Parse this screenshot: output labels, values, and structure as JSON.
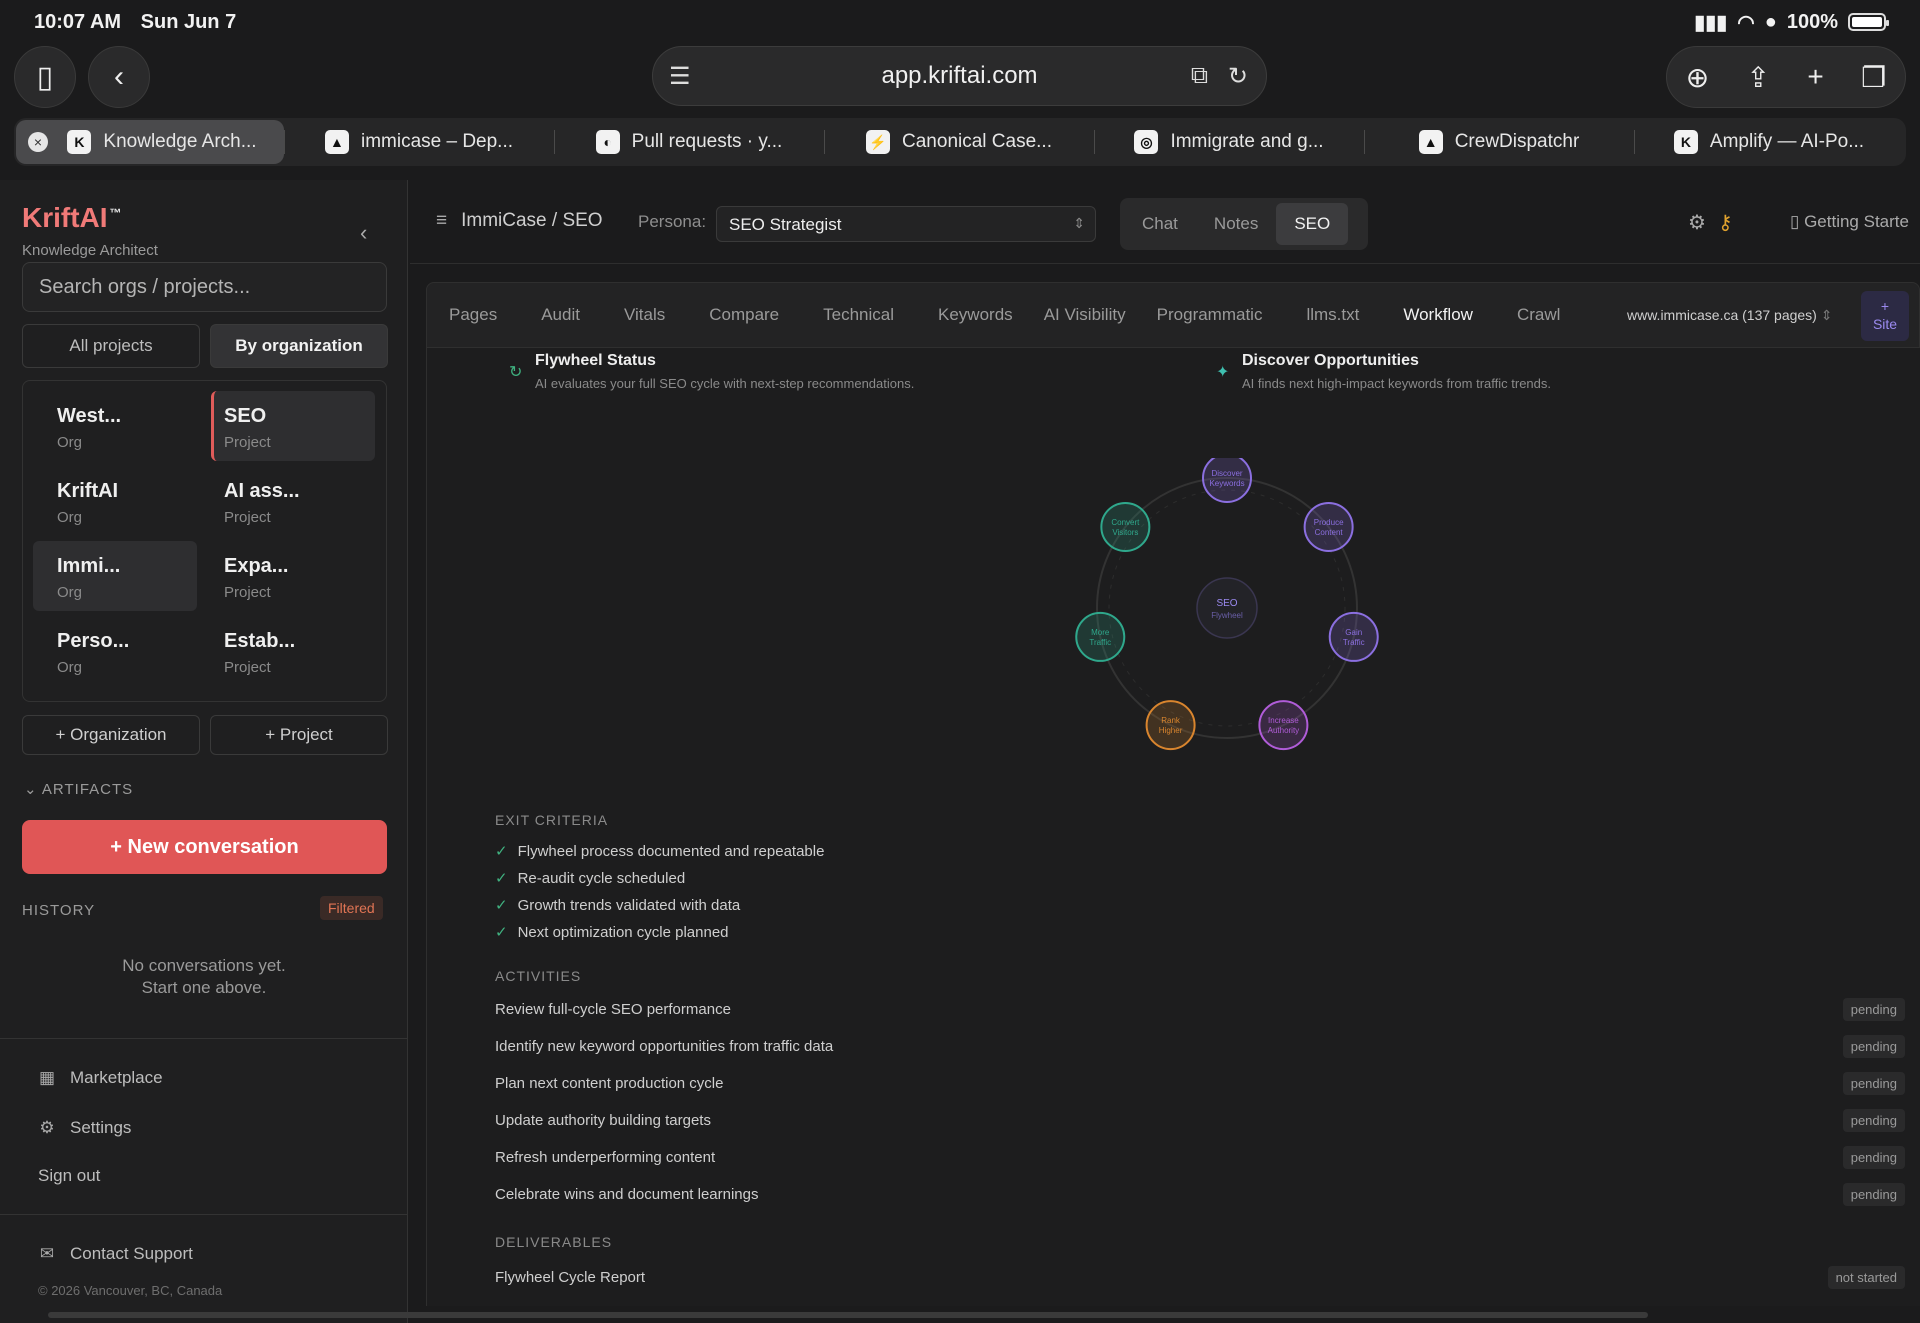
{
  "status": {
    "time": "10:07 AM",
    "date": "Sun Jun 7",
    "battery": "100%",
    "battery_level": 1.0
  },
  "browser": {
    "url": "app.kriftai.com",
    "tabs": [
      {
        "label": "Knowledge Arch...",
        "fav": "K",
        "active": true
      },
      {
        "label": "immicase – Dep...",
        "fav": "▲"
      },
      {
        "label": "Pull requests · y...",
        "fav": "◐"
      },
      {
        "label": "Canonical Case...",
        "fav": "⚡"
      },
      {
        "label": "Immigrate and g...",
        "fav": "◎"
      },
      {
        "label": "CrewDispatchr",
        "fav": "▲"
      },
      {
        "label": "Amplify — AI-Po...",
        "fav": "K"
      }
    ]
  },
  "sidebar": {
    "brand": "KriftAI",
    "tm": "™",
    "subtitle": "Knowledge Architect",
    "search_placeholder": "Search orgs / projects...",
    "seg_all": "All projects",
    "seg_org": "By organization",
    "orgs": [
      {
        "name": "West...",
        "kind": "Org"
      },
      {
        "name": "KriftAI",
        "kind": "Org"
      },
      {
        "name": "Immi...",
        "kind": "Org"
      },
      {
        "name": "Perso...",
        "kind": "Org"
      }
    ],
    "projects": [
      {
        "name": "SEO",
        "kind": "Project"
      },
      {
        "name": "AI ass...",
        "kind": "Project"
      },
      {
        "name": "Expa...",
        "kind": "Project"
      },
      {
        "name": "Estab...",
        "kind": "Project"
      }
    ],
    "add_org": "+ Organization",
    "add_project": "+ Project",
    "artifacts": "ARTIFACTS",
    "new_conversation": "+ New conversation",
    "history": "HISTORY",
    "filtered": "Filtered",
    "empty_line1": "No conversations yet.",
    "empty_line2": "Start one above.",
    "marketplace": "Marketplace",
    "settings": "Settings",
    "signout": "Sign out",
    "contact": "Contact Support",
    "copyright": "© 2026 Vancouver, BC, Canada"
  },
  "header": {
    "crumb": "ImmiCase / SEO",
    "persona_label": "Persona:",
    "persona_value": "SEO Strategist",
    "modes": [
      "Chat",
      "Notes",
      "SEO"
    ],
    "getting_started": "Getting Starte"
  },
  "seo_tabs": [
    "Pages",
    "Audit",
    "Vitals",
    "Compare",
    "Technical",
    "Keywords",
    "AI Visibility",
    "Programmatic",
    "llms.txt",
    "Workflow",
    "Crawl"
  ],
  "site": "www.immicase.ca (137 pages)",
  "site_btn_plus": "+",
  "site_btn": "Site",
  "cards": {
    "flywheel_title": "Flywheel Status",
    "flywheel_desc": "AI evaluates your full SEO cycle with next-step recommendations.",
    "discover_title": "Discover Opportunities",
    "discover_desc": "AI finds next high-impact keywords from traffic trends."
  },
  "diagram": {
    "center": [
      "SEO",
      "Flywheel"
    ],
    "nodes": [
      {
        "l1": "Discover",
        "l2": "Keywords",
        "color": "#8b6fe0"
      },
      {
        "l1": "Produce",
        "l2": "Content",
        "color": "#8b6fe0"
      },
      {
        "l1": "Gain",
        "l2": "Traffic",
        "color": "#8b6fe0"
      },
      {
        "l1": "Increase",
        "l2": "Authority",
        "color": "#b05cd8"
      },
      {
        "l1": "Rank",
        "l2": "Higher",
        "color": "#d9852e"
      },
      {
        "l1": "More",
        "l2": "Traffic",
        "color": "#2fa88c"
      },
      {
        "l1": "Convert",
        "l2": "Visitors",
        "color": "#2fa88c"
      }
    ]
  },
  "exit_criteria_h": "EXIT CRITERIA",
  "exit_criteria": [
    "Flywheel process documented and repeatable",
    "Re-audit cycle scheduled",
    "Growth trends validated with data",
    "Next optimization cycle planned"
  ],
  "activities_h": "ACTIVITIES",
  "activities": [
    {
      "label": "Review full-cycle SEO performance",
      "status": "pending"
    },
    {
      "label": "Identify new keyword opportunities from traffic data",
      "status": "pending"
    },
    {
      "label": "Plan next content production cycle",
      "status": "pending"
    },
    {
      "label": "Update authority building targets",
      "status": "pending"
    },
    {
      "label": "Refresh underperforming content",
      "status": "pending"
    },
    {
      "label": "Celebrate wins and document learnings",
      "status": "pending"
    }
  ],
  "deliverables_h": "DELIVERABLES",
  "deliverables": [
    {
      "label": "Flywheel Cycle Report",
      "status": "not started"
    }
  ]
}
